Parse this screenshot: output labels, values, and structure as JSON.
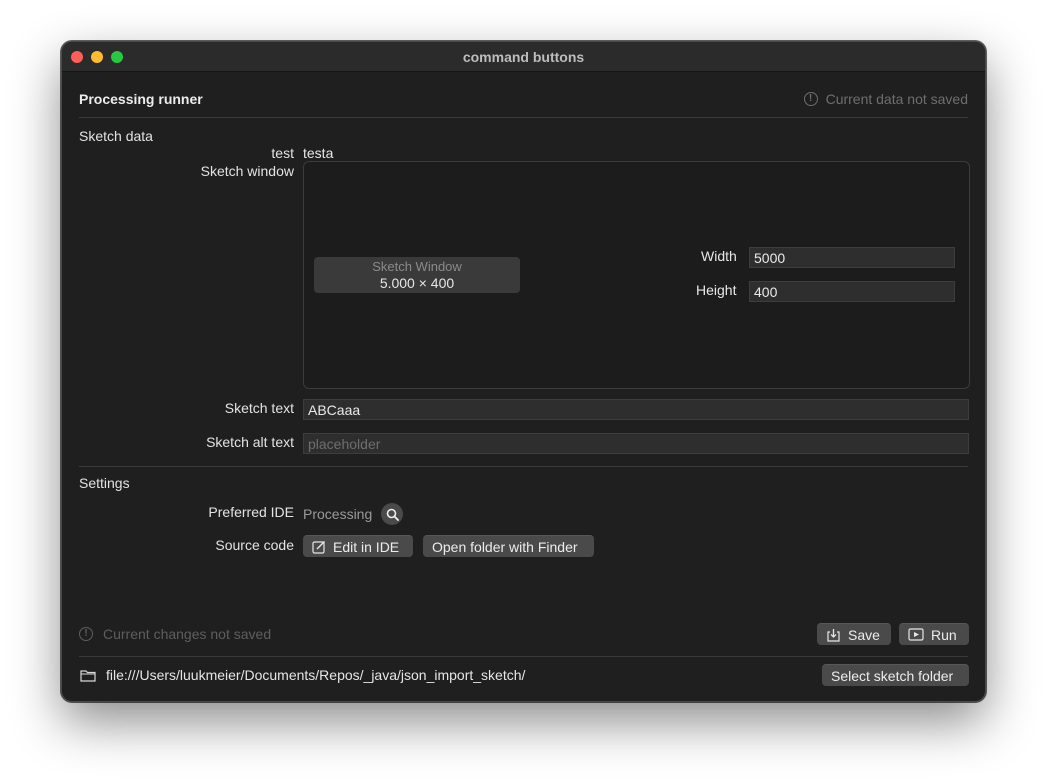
{
  "window": {
    "title": "command buttons"
  },
  "header": {
    "title": "Processing runner",
    "status": "Current data not saved",
    "status_icon": "info-icon"
  },
  "sketch_data": {
    "section_title": "Sketch data",
    "test_label": "test",
    "test_value": "testa",
    "sketch_window_label": "Sketch window",
    "preview": {
      "title": "Sketch Window",
      "dimensions": "5.000 × 400"
    },
    "width_label": "Width",
    "width_value": "5000",
    "height_label": "Height",
    "height_value": "400",
    "sketch_text_label": "Sketch text",
    "sketch_text_value": "ABCaaa",
    "sketch_alt_text_label": "Sketch alt text",
    "sketch_alt_text_placeholder": "placeholder"
  },
  "settings": {
    "section_title": "Settings",
    "preferred_ide_label": "Preferred IDE",
    "preferred_ide_value": "Processing",
    "source_code_label": "Source code",
    "edit_in_ide_label": "Edit in IDE",
    "open_folder_label": "Open folder with Finder"
  },
  "footer": {
    "status": "Current changes not saved",
    "save_label": "Save",
    "run_label": "Run",
    "path": "file:///Users/luukmeier/Documents/Repos/_java/json_import_sketch/",
    "select_folder_label": "Select sketch folder"
  },
  "colors": {
    "window_bg": "#1f1f1f",
    "titlebar_bg": "#2b2b2b",
    "button_bg": "#4a4a4a",
    "close": "#ff5f57",
    "minimize": "#febc2e",
    "maximize": "#28c840"
  }
}
